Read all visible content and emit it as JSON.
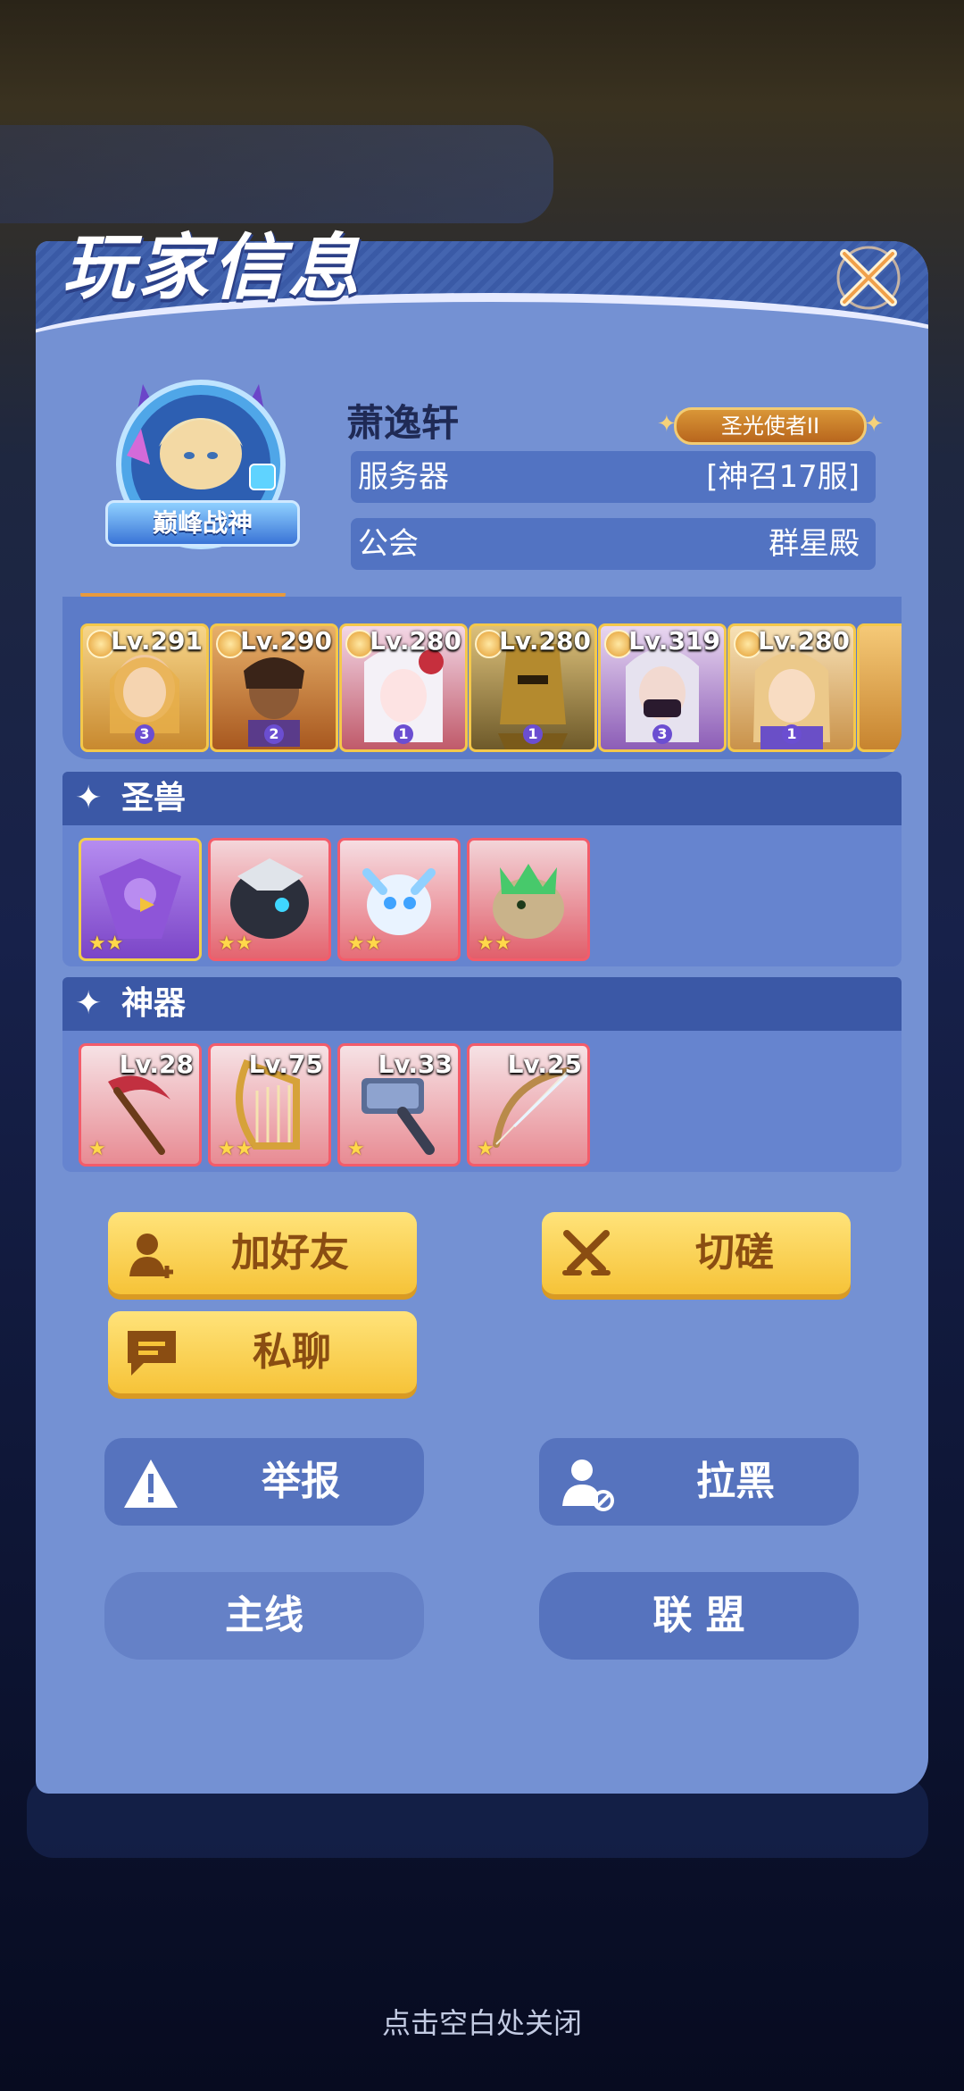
{
  "title": "玩家信息",
  "player": {
    "name": "萧逸轩",
    "avatar_badge": "巅峰战神",
    "rank_title": "圣光使者II",
    "server_label": "服务器",
    "server_value": "[神召17服]",
    "guild_label": "公会",
    "guild_value": "群星殿"
  },
  "heroes": [
    {
      "level": "Lv.291",
      "stars": "3"
    },
    {
      "level": "Lv.290",
      "stars": "2"
    },
    {
      "level": "Lv.280",
      "stars": "1"
    },
    {
      "level": "Lv.280",
      "stars": "1"
    },
    {
      "level": "Lv.319",
      "stars": "3"
    },
    {
      "level": "Lv.280",
      "stars": "1"
    }
  ],
  "beasts_section": {
    "title": "圣兽",
    "items": [
      {
        "name": "purple-eagle",
        "stars": "★★"
      },
      {
        "name": "dark-beast",
        "stars": "★★"
      },
      {
        "name": "ice-dragon",
        "stars": "★★"
      },
      {
        "name": "green-dragon",
        "stars": "★★"
      }
    ]
  },
  "artifacts_section": {
    "title": "神器",
    "items": [
      {
        "name": "scythe",
        "level": "Lv.28",
        "stars": "★"
      },
      {
        "name": "harp",
        "level": "Lv.75",
        "stars": "★★"
      },
      {
        "name": "hammer",
        "level": "Lv.33",
        "stars": "★"
      },
      {
        "name": "bow",
        "level": "Lv.25",
        "stars": "★"
      }
    ]
  },
  "buttons": {
    "add_friend": "加好友",
    "challenge": "切磋",
    "private_chat": "私聊",
    "report": "举报",
    "block": "拉黑",
    "main_line": "主线",
    "alliance": "联 盟"
  },
  "close_hint": "点击空白处关闭",
  "colors": {
    "panel": "#7491d3",
    "section_header": "#3b58a6",
    "yellow_button": "#f6c338",
    "blue_button": "#5673be"
  }
}
